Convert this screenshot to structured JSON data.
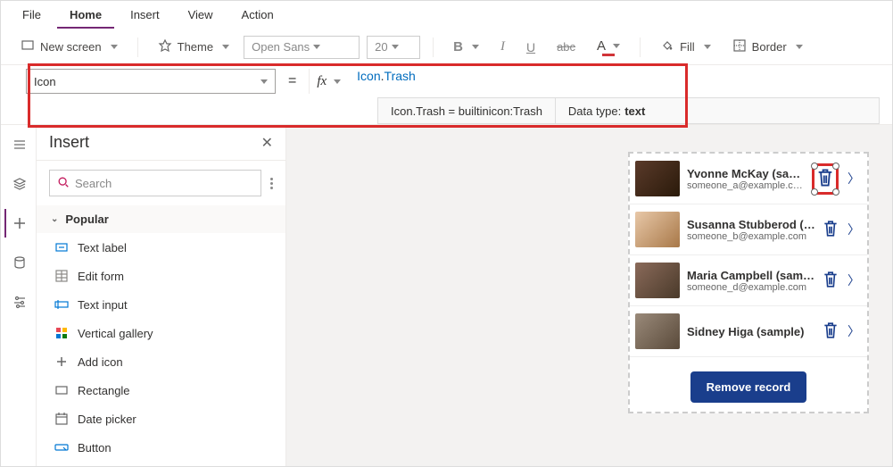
{
  "menu": {
    "tabs": [
      "File",
      "Home",
      "Insert",
      "View",
      "Action"
    ],
    "active": "Home"
  },
  "ribbon": {
    "new_screen": "New screen",
    "theme": "Theme",
    "font_family": "Open Sans",
    "font_size": "20",
    "fill": "Fill",
    "border": "Border"
  },
  "formula_bar": {
    "property": "Icon",
    "equals": "=",
    "fx": "fx",
    "value": "Icon.Trash",
    "tooltip_left": "Icon.Trash = builtinicon:Trash",
    "tooltip_dt_label": "Data type:",
    "tooltip_dt_value": "text"
  },
  "insert_panel": {
    "title": "Insert",
    "search_placeholder": "Search",
    "group": "Popular",
    "items": [
      "Text label",
      "Edit form",
      "Text input",
      "Vertical gallery",
      "Add icon",
      "Rectangle",
      "Date picker",
      "Button"
    ]
  },
  "gallery": {
    "items": [
      {
        "name": "Yvonne McKay (sample)",
        "email": "someone_a@example.com"
      },
      {
        "name": "Susanna Stubberod (sample)",
        "email": "someone_b@example.com"
      },
      {
        "name": "Maria Campbell (sample)",
        "email": "someone_d@example.com"
      },
      {
        "name": "Sidney Higa (sample)",
        "email": ""
      }
    ],
    "remove_button": "Remove record"
  }
}
